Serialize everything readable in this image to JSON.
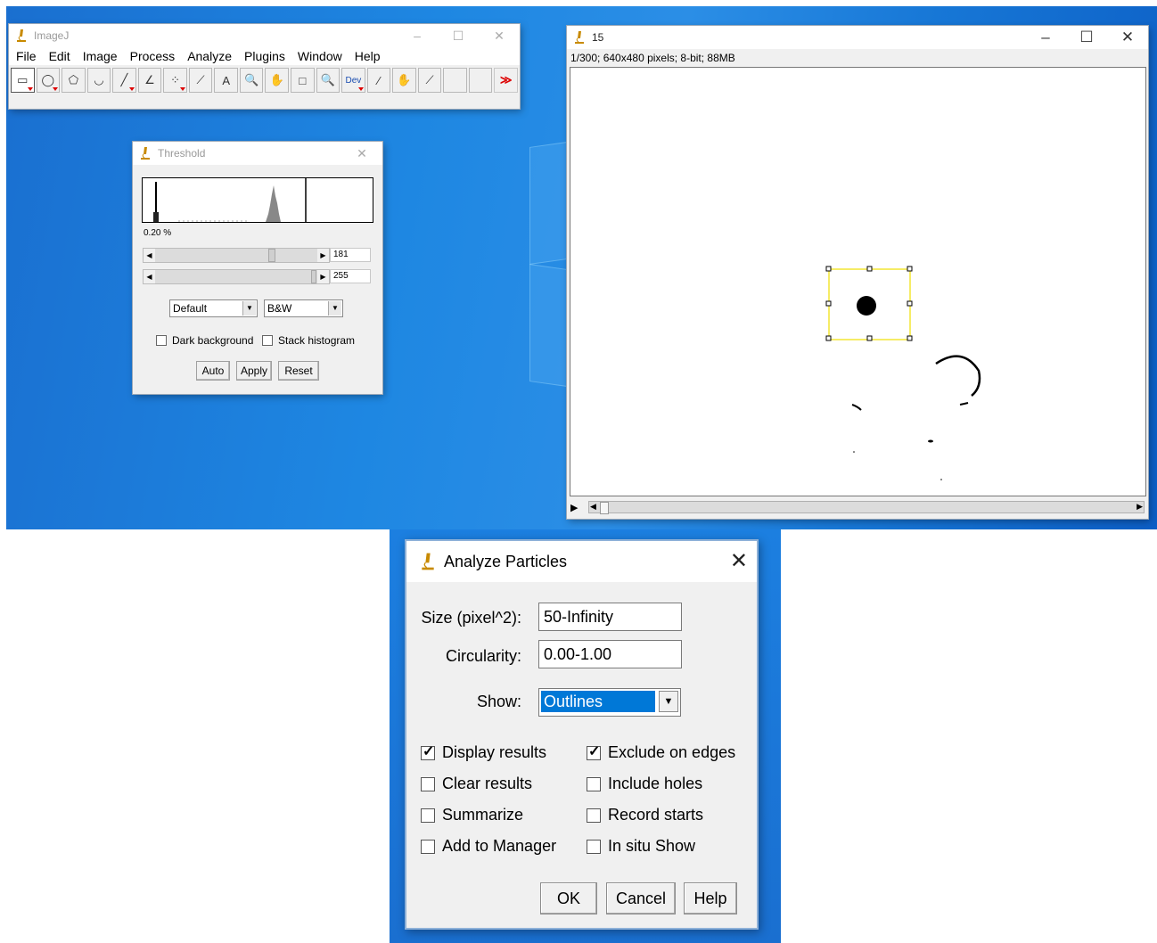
{
  "imagej": {
    "title": "ImageJ",
    "menu": [
      "File",
      "Edit",
      "Image",
      "Process",
      "Analyze",
      "Plugins",
      "Window",
      "Help"
    ],
    "tools": [
      {
        "name": "rectangle-tool",
        "glyph": "▭",
        "selected": true
      },
      {
        "name": "oval-tool",
        "glyph": "◯"
      },
      {
        "name": "polygon-tool",
        "glyph": "⬠"
      },
      {
        "name": "freehand-tool",
        "glyph": "◡"
      },
      {
        "name": "line-tool",
        "glyph": "╱"
      },
      {
        "name": "angle-tool",
        "glyph": "∠"
      },
      {
        "name": "point-tool",
        "glyph": "⁘"
      },
      {
        "name": "wand-tool",
        "glyph": "⟋"
      },
      {
        "name": "text-tool",
        "glyph": "A"
      },
      {
        "name": "magnifier-tool",
        "glyph": "🔍"
      },
      {
        "name": "hand-tool",
        "glyph": "✋"
      },
      {
        "name": "color-picker-tool",
        "glyph": "□"
      },
      {
        "name": "zoom-tool",
        "glyph": "🔍"
      },
      {
        "name": "dev-tool",
        "glyph": "Dev"
      },
      {
        "name": "brush-tool",
        "glyph": "∕"
      },
      {
        "name": "flood-tool",
        "glyph": "✋"
      },
      {
        "name": "pipette-tool",
        "glyph": "⟋"
      },
      {
        "name": "empty-tool-1",
        "glyph": ""
      },
      {
        "name": "empty-tool-2",
        "glyph": ""
      },
      {
        "name": "more-tools",
        "glyph": "≫"
      }
    ]
  },
  "threshold": {
    "title": "Threshold",
    "percent": "0.20 %",
    "min_value": "181",
    "max_value": "255",
    "method": "Default",
    "mode": "B&W",
    "dark_background": "Dark background",
    "stack_histogram": "Stack histogram",
    "auto": "Auto",
    "apply": "Apply",
    "reset": "Reset"
  },
  "image_window": {
    "title": "15",
    "info": "1/300; 640x480 pixels; 8-bit; 88MB"
  },
  "analyze": {
    "title": "Analyze Particles",
    "size_label": "Size (pixel^2):",
    "size_value": "50-Infinity",
    "circ_label": "Circularity:",
    "circ_value": "0.00-1.00",
    "show_label": "Show:",
    "show_value": "Outlines",
    "checks": {
      "display_results": {
        "label": "Display results",
        "checked": true
      },
      "exclude_edges": {
        "label": "Exclude on edges",
        "checked": true
      },
      "clear_results": {
        "label": "Clear results",
        "checked": false
      },
      "include_holes": {
        "label": "Include holes",
        "checked": false
      },
      "summarize": {
        "label": "Summarize",
        "checked": false
      },
      "record_starts": {
        "label": "Record starts",
        "checked": false
      },
      "add_manager": {
        "label": "Add to Manager",
        "checked": false
      },
      "in_situ": {
        "label": "In situ Show",
        "checked": false
      }
    },
    "ok": "OK",
    "cancel": "Cancel",
    "help": "Help"
  },
  "colors": {
    "desktop": "#1a78da",
    "selection": "#f0e000",
    "show_highlight": "#0078d7"
  }
}
